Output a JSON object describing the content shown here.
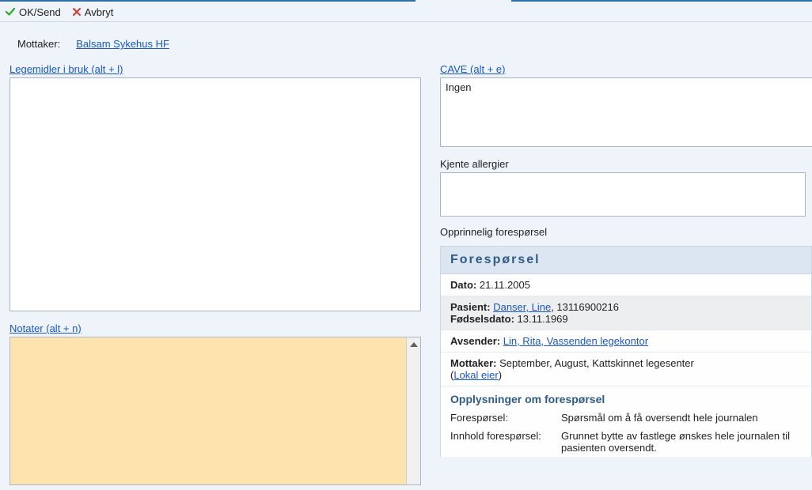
{
  "toolbar": {
    "ok": "OK/Send",
    "cancel": "Avbryt"
  },
  "mottaker_label": "Mottaker:",
  "mottaker_link": "Balsam Sykehus HF",
  "left": {
    "legemidler_link": "Legemidler i bruk (alt + l)",
    "notater_link": "Notater (alt + n)"
  },
  "right": {
    "cave_link": "CAVE (alt + e)",
    "cave_text": "Ingen",
    "allergi_label": "Kjente allergier",
    "opprin_label": "Opprinnelig forespørsel",
    "panel_header": "Forespørsel",
    "dato_label": "Dato:",
    "dato_val": "21.11.2005",
    "pasient_label": "Pasient:",
    "pasient_link": "Danser, Line",
    "pasient_id": ", 13116900216",
    "fdato_label": "Fødselsdato:",
    "fdato_val": "13.11.1969",
    "avsender_label": "Avsender:",
    "avsender_link": "Lin, Rita, Vassenden legekontor",
    "mottaker_label": "Mottaker:",
    "mottaker_val": "September, August, Kattskinnet legesenter",
    "lokal_eier": "Lokal eier",
    "oppl_header": "Opplysninger om forespørsel",
    "fsp_label": "Forespørsel:",
    "fsp_val": "Spørsmål om å få oversendt hele journalen",
    "innhold_label": "Innhold forespørsel:",
    "innhold_val": "Grunnet bytte av fastlege ønskes hele journalen til pasienten oversendt."
  }
}
